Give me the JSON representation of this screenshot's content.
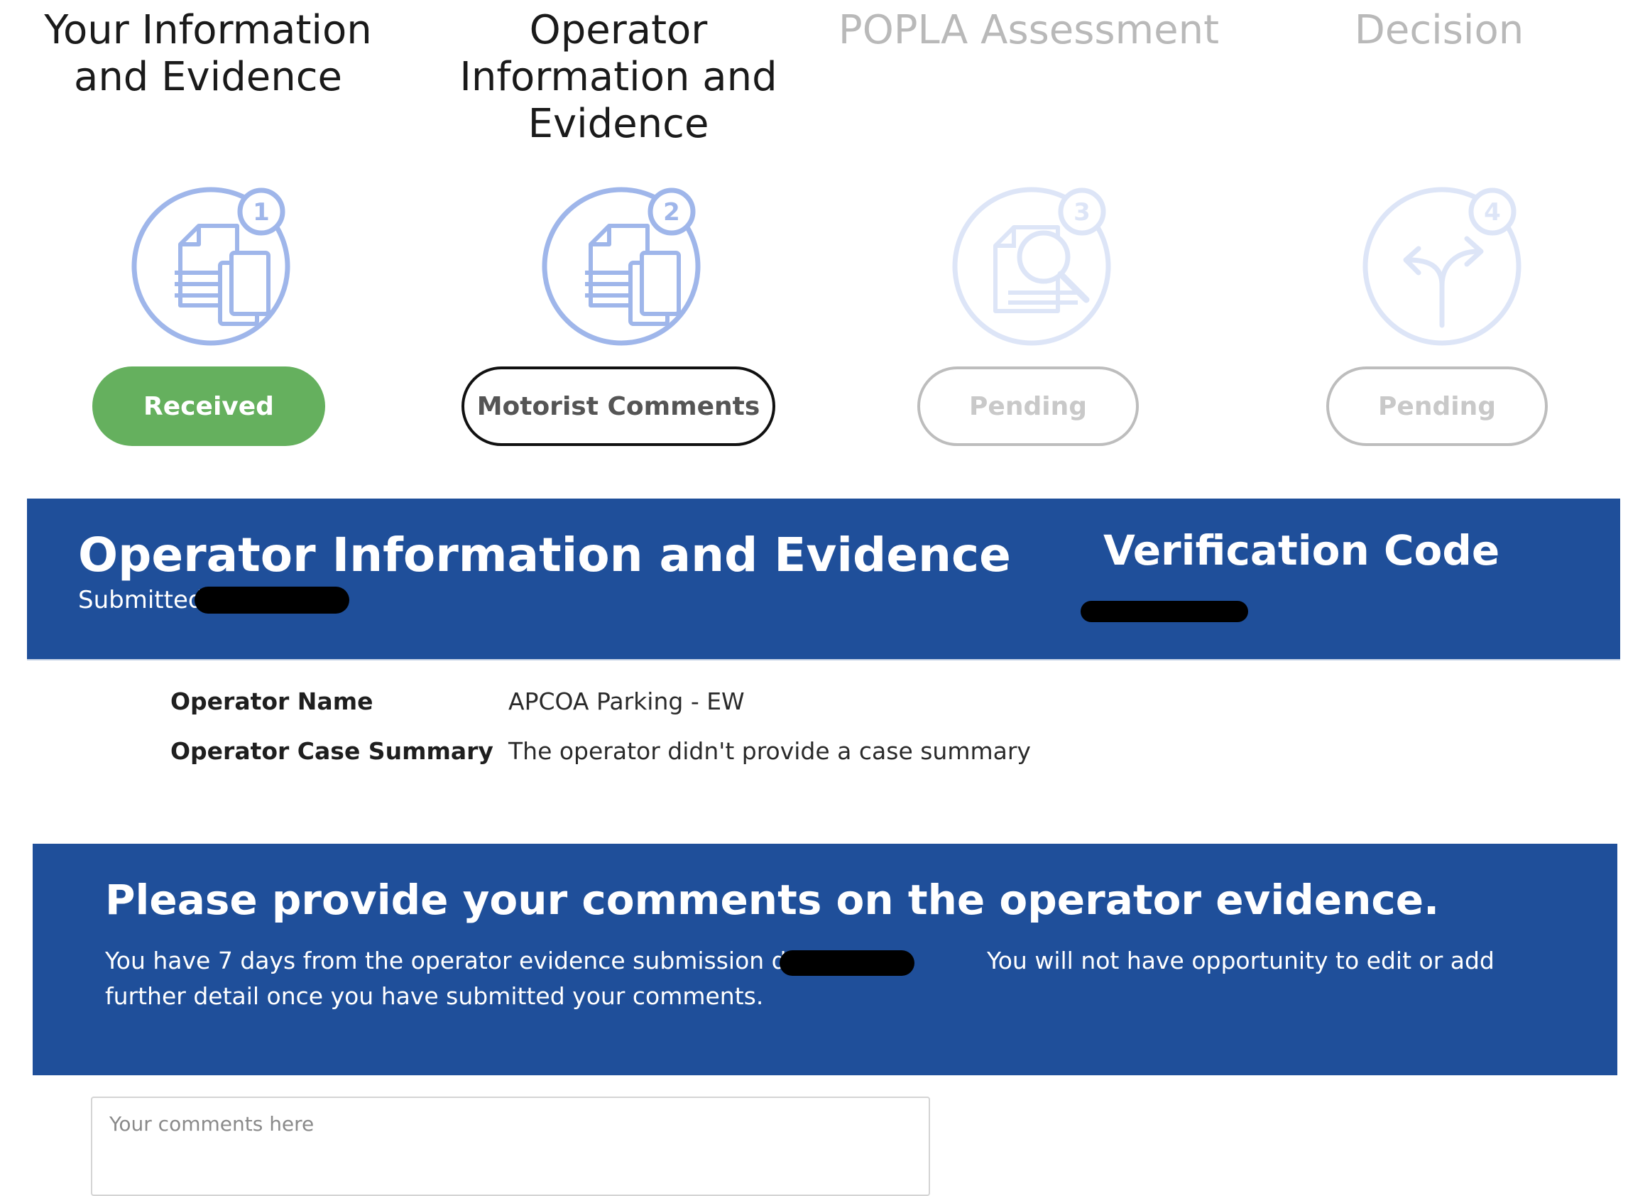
{
  "steps": [
    {
      "title": "Your Information\nand Evidence",
      "status": "Received",
      "number": "1",
      "icon": "documents-icon"
    },
    {
      "title": "Operator\nInformation and\nEvidence",
      "status": "Motorist Comments",
      "number": "2",
      "icon": "documents-icon"
    },
    {
      "title": "POPLA Assessment",
      "status": "Pending",
      "number": "3",
      "icon": "document-search-icon"
    },
    {
      "title": "Decision",
      "status": "Pending",
      "number": "4",
      "icon": "split-arrows-icon"
    }
  ],
  "operator_header": {
    "title": "Operator Information and Evidence",
    "submitted_label": "Submitted",
    "verification_label": "Verification Code"
  },
  "details": {
    "operator_name_label": "Operator Name",
    "operator_name_value": "APCOA Parking - EW",
    "case_summary_label": "Operator Case Summary",
    "case_summary_value": "The operator didn't provide a case summary"
  },
  "instructions": {
    "title": "Please provide your comments on the operator evidence.",
    "text_before": "You have 7 days from the operator evidence submission date - ",
    "text_after": "You will not have opportunity to edit or add further detail once you have submitted your comments."
  },
  "comments": {
    "placeholder": "Your comments here"
  },
  "colors": {
    "brand_blue": "#1f4f9a",
    "icon_blue": "#9fb6ea",
    "received_green": "#65b05e"
  }
}
